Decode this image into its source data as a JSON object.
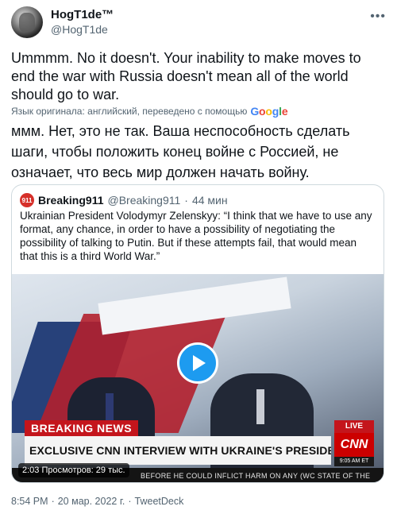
{
  "author": {
    "display_name": "HogT1de™",
    "handle": "@HogT1de"
  },
  "tweet": {
    "text": "Ummmm. No it doesn't. Your inability to make moves to end the war with Russia doesn't mean all of the world should go to war.",
    "translation_note": "Язык оригинала: английский, переведено с помощью",
    "translation_provider": "Google",
    "translated_text": "ммм. Нет, это не так. Ваша неспособность сделать шаги, чтобы положить конец войне с Россией, не означает, что весь мир должен начать войну.",
    "more_icon": "more-horizontal-icon"
  },
  "quote": {
    "avatar_label": "911",
    "display_name": "Breaking911",
    "handle": "@Breaking911",
    "separator": "·",
    "time": "44 мин",
    "text": "Ukrainian President Volodymyr Zelenskyy: “I think that we have to use any format, any chance, in order to have a possibility of negotiating the possibility of talking to Putin. But if these attempts fail, that would mean that this is a third World War.”"
  },
  "video": {
    "breaking_label": "BREAKING NEWS",
    "headline": "EXCLUSIVE CNN INTERVIEW WITH UKRAINE'S PRESIDENT ZELENSKY",
    "live_label": "LIVE",
    "network": "CNN",
    "network_time": "9:05 AM ET",
    "ticker": "BEFORE HE COULD INFLICT HARM ON ANY (WC  STATE OF THE",
    "stats": "2:03  Просмотров: 29 тыс.",
    "play_icon": "play-icon"
  },
  "footer": {
    "time": "8:54 PM",
    "separator1": "·",
    "date": "20 мар. 2022 г.",
    "separator2": "·",
    "source": "TweetDeck"
  },
  "colors": {
    "accent": "#1d9bf0",
    "text_primary": "#0f1419",
    "text_secondary": "#536471",
    "border": "#cfd9de",
    "breaking_red": "#c4151c"
  }
}
